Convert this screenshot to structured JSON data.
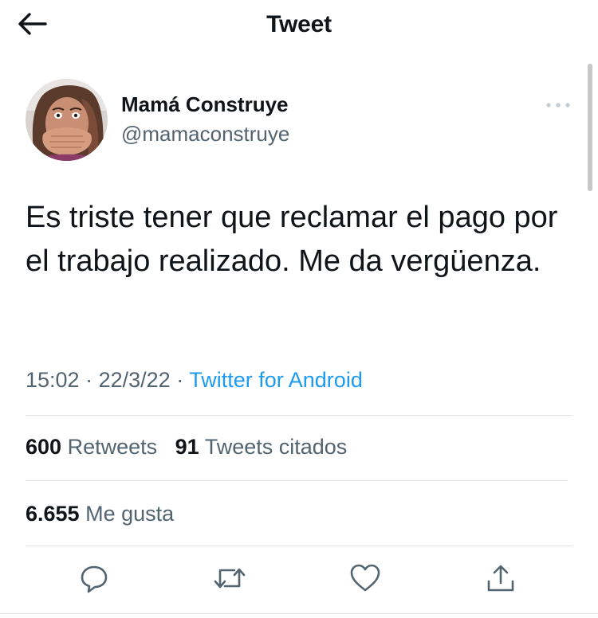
{
  "header": {
    "title": "Tweet",
    "back_icon": "arrow-left-icon"
  },
  "user": {
    "name": "Mamá Construye",
    "handle": "@mamaconstruye",
    "avatar_icon": "user-avatar"
  },
  "tweet": {
    "text": "Es triste tener que reclamar el pago por el trabajo realizado. Me da vergüenza.",
    "time": "15:02",
    "date": "22/3/22",
    "separator": "·",
    "source": "Twitter for Android"
  },
  "stats": {
    "retweets_count": "600",
    "retweets_label": "Retweets",
    "quotes_count": "91",
    "quotes_label": "Tweets citados",
    "likes_count": "6.655",
    "likes_label": "Me gusta"
  },
  "actions": [
    {
      "icon": "reply-icon"
    },
    {
      "icon": "retweet-icon"
    },
    {
      "icon": "like-icon"
    },
    {
      "icon": "share-icon"
    }
  ],
  "colors": {
    "accent": "#1d9bf0",
    "text": "#0f1419",
    "secondary": "#536471",
    "divider": "#e1e5e8"
  }
}
